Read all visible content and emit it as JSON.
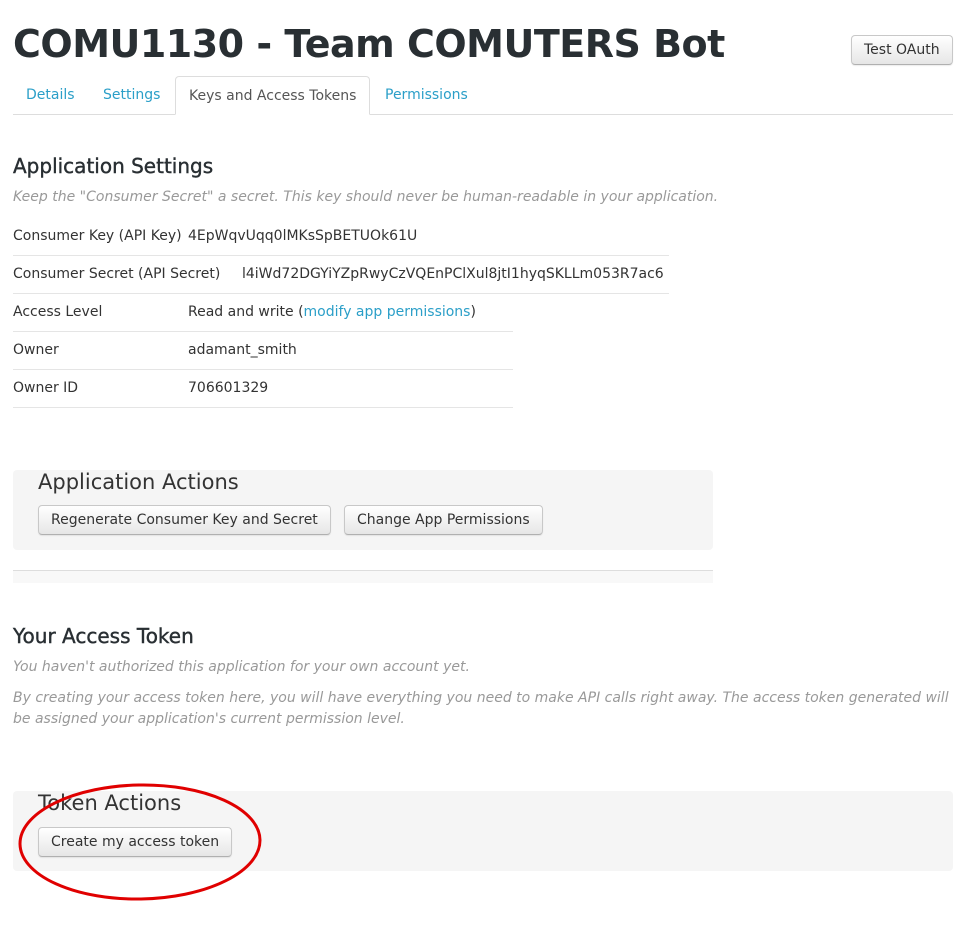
{
  "header": {
    "title": "COMU1130 - Team COMUTERS Bot",
    "test_oauth_label": "Test OAuth"
  },
  "tabs": [
    {
      "label": "Details",
      "active": false
    },
    {
      "label": "Settings",
      "active": false
    },
    {
      "label": "Keys and Access Tokens",
      "active": true
    },
    {
      "label": "Permissions",
      "active": false
    }
  ],
  "app_settings": {
    "heading": "Application Settings",
    "note": "Keep the \"Consumer Secret\" a secret. This key should never be human-readable in your application.",
    "rows": [
      {
        "label": "Consumer Key (API Key)",
        "value": "4EpWqvUqq0lMKsSpBETUOk61U"
      },
      {
        "label": "Consumer Secret (API Secret)",
        "value": "l4iWd72DGYiYZpRwyCzVQEnPClXul8jtI1hyqSKLLm053R7ac6"
      },
      {
        "label": "Access Level",
        "value_prefix": "Read and write (",
        "value_link": "modify app permissions",
        "value_suffix": ")"
      },
      {
        "label": "Owner",
        "value": "adamant_smith"
      },
      {
        "label": "Owner ID",
        "value": "706601329"
      }
    ]
  },
  "app_actions": {
    "title": "Application Actions",
    "regenerate_label": "Regenerate Consumer Key and Secret",
    "change_permissions_label": "Change App Permissions"
  },
  "access_token": {
    "heading": "Your Access Token",
    "note_1": "You haven't authorized this application for your own account yet.",
    "note_2": "By creating your access token here, you will have everything you need to make API calls right away. The access token generated will be assigned your application's current permission level."
  },
  "token_actions": {
    "title": "Token Actions",
    "create_label": "Create my access token"
  },
  "colors": {
    "link": "#2b9fc8",
    "annotation": "#e00000",
    "panel_bg": "#f5f5f5"
  }
}
